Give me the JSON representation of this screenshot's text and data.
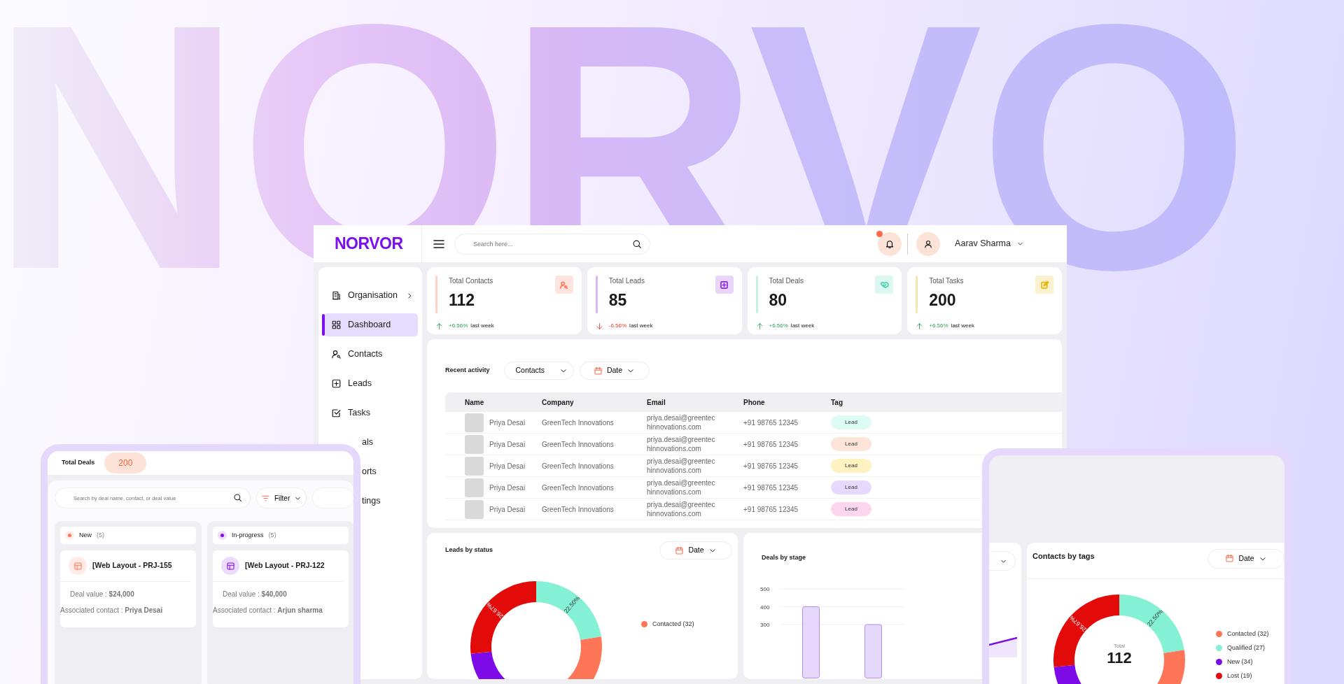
{
  "backdrop_title": "NORVO",
  "app": {
    "logo": "NORVOR",
    "search_placeholder": "Search here...",
    "notification_unread": true,
    "user": {
      "name": "Aarav Sharma"
    }
  },
  "sidebar": {
    "items": [
      {
        "label": "Organisation",
        "kind": "building",
        "selected": false,
        "has_submenu": true
      },
      {
        "label": "Dashboard",
        "kind": "grid",
        "selected": true,
        "has_submenu": false
      },
      {
        "label": "Contacts",
        "kind": "person",
        "selected": false,
        "has_submenu": false
      },
      {
        "label": "Leads",
        "kind": "plus",
        "selected": false,
        "has_submenu": false
      },
      {
        "label": "Tasks",
        "kind": "check",
        "selected": false,
        "has_submenu": false
      },
      {
        "label": "als",
        "kind": "covered",
        "selected": false,
        "has_submenu": false
      },
      {
        "label": "orts",
        "kind": "covered",
        "selected": false,
        "has_submenu": false
      },
      {
        "label": "tings",
        "kind": "covered",
        "selected": false,
        "has_submenu": false
      }
    ]
  },
  "stats": [
    {
      "label": "Total Contacts",
      "value": "112",
      "change": "+6.56%",
      "period": "last week",
      "rising": true,
      "color": "#ff7a59",
      "kind": "person"
    },
    {
      "label": "Total Leads",
      "value": "85",
      "change": "-6.56%",
      "period": "last week",
      "rising": false,
      "color": "#8a2be2",
      "kind": "plus"
    },
    {
      "label": "Total Deals",
      "value": "80",
      "change": "+6.56%",
      "period": "last week",
      "rising": true,
      "color": "#4fd1b5",
      "kind": "handshake"
    },
    {
      "label": "Total Tasks",
      "value": "200",
      "change": "+6.56%",
      "period": "last week",
      "rising": true,
      "color": "#e8b70e",
      "kind": "edit"
    }
  ],
  "activity": {
    "title": "Recent activity",
    "filter": "Contacts",
    "date_button": "Date",
    "columns": [
      "Name",
      "Company",
      "Email",
      "Phone",
      "Tag"
    ],
    "rows": [
      {
        "name": "Priya Desai",
        "company": "GreenTech Innovations",
        "email": "priya.desai@greentechinnovations.com",
        "phone": "+91 98765 12345",
        "tag": "Lead",
        "color": "#dcfbf2"
      },
      {
        "name": "Priya Desai",
        "company": "GreenTech Innovations",
        "email": "priya.desai@greentechinnovations.com",
        "phone": "+91 98765 12345",
        "tag": "Lead",
        "color": "#fde4d8"
      },
      {
        "name": "Priya Desai",
        "company": "GreenTech Innovations",
        "email": "priya.desai@greentechinnovations.com",
        "phone": "+91 98765 12345",
        "tag": "Lead",
        "color": "#fdf2c0"
      },
      {
        "name": "Priya Desai",
        "company": "GreenTech Innovations",
        "email": "priya.desai@greentechinnovations.com",
        "phone": "+91 98765 12345",
        "tag": "Lead",
        "color": "#e5d9fd"
      },
      {
        "name": "Priya Desai",
        "company": "GreenTech Innovations",
        "email": "priya.desai@greentechinnovations.com",
        "phone": "+91 98765 12345",
        "tag": "Lead",
        "color": "#fbd6ee"
      }
    ]
  },
  "leads_by_status": {
    "title": "Leads by status",
    "date_button": "Date",
    "chart_data": {
      "type": "donut",
      "values": [
        22.5,
        22.5,
        28.33,
        26.67
      ],
      "colors": [
        "#84f0d4",
        "#ff7557",
        "#7d0be8",
        "#e30a0a"
      ],
      "value_labels": [
        "22.50%",
        null,
        null,
        "26.67%"
      ]
    },
    "legend": [
      {
        "label": "Contacted (32)",
        "color": "#ff7557"
      }
    ]
  },
  "deals_by_stage": {
    "title": "Deals by stage",
    "chart_data": {
      "type": "bar",
      "values": [
        400,
        300
      ],
      "ylim": [
        0,
        500
      ],
      "yticks": [
        300,
        400,
        500
      ]
    }
  },
  "deals_board": {
    "title": "Total Deals",
    "total": "200",
    "search_placeholder": "Search by deal name, contact, or deal value",
    "filter_button": "Filter",
    "columns": [
      {
        "label": "New",
        "count": "(5)",
        "color": "#ff7557",
        "deal": {
          "title": "[Web Layout - PRJ-155",
          "value_text": "Deal value : **$24,000**",
          "contact_text": "Associated contact : **Priya Desai**"
        }
      },
      {
        "label": "In-progress",
        "count": "(5)",
        "color": "#7d0be8",
        "deal": {
          "title": "[Web Layout - PRJ-122",
          "value_text": "Deal value : **$40,000**",
          "contact_text": "Associated contact : **Arjun sharma**"
        }
      }
    ]
  },
  "contacts_by_tags": {
    "title": "Contacts by tags",
    "date_button": "Date",
    "total_label": "Total",
    "total": "112",
    "chart_data": {
      "type": "donut",
      "values": [
        22.5,
        22.5,
        28.33,
        26.67
      ],
      "colors": [
        "#84f0d4",
        "#ff7557",
        "#7d0be8",
        "#e30a0a"
      ],
      "value_labels": [
        "22.50%",
        null,
        null,
        "26.67%"
      ]
    },
    "legend": [
      {
        "label": "Contacted (32)",
        "color": "#ff7557"
      },
      {
        "label": "Qualified (27)",
        "color": "#84f0d4"
      },
      {
        "label": "New (34)",
        "color": "#7d0be8"
      },
      {
        "label": "Lost (19)",
        "color": "#e30a0a"
      }
    ]
  }
}
